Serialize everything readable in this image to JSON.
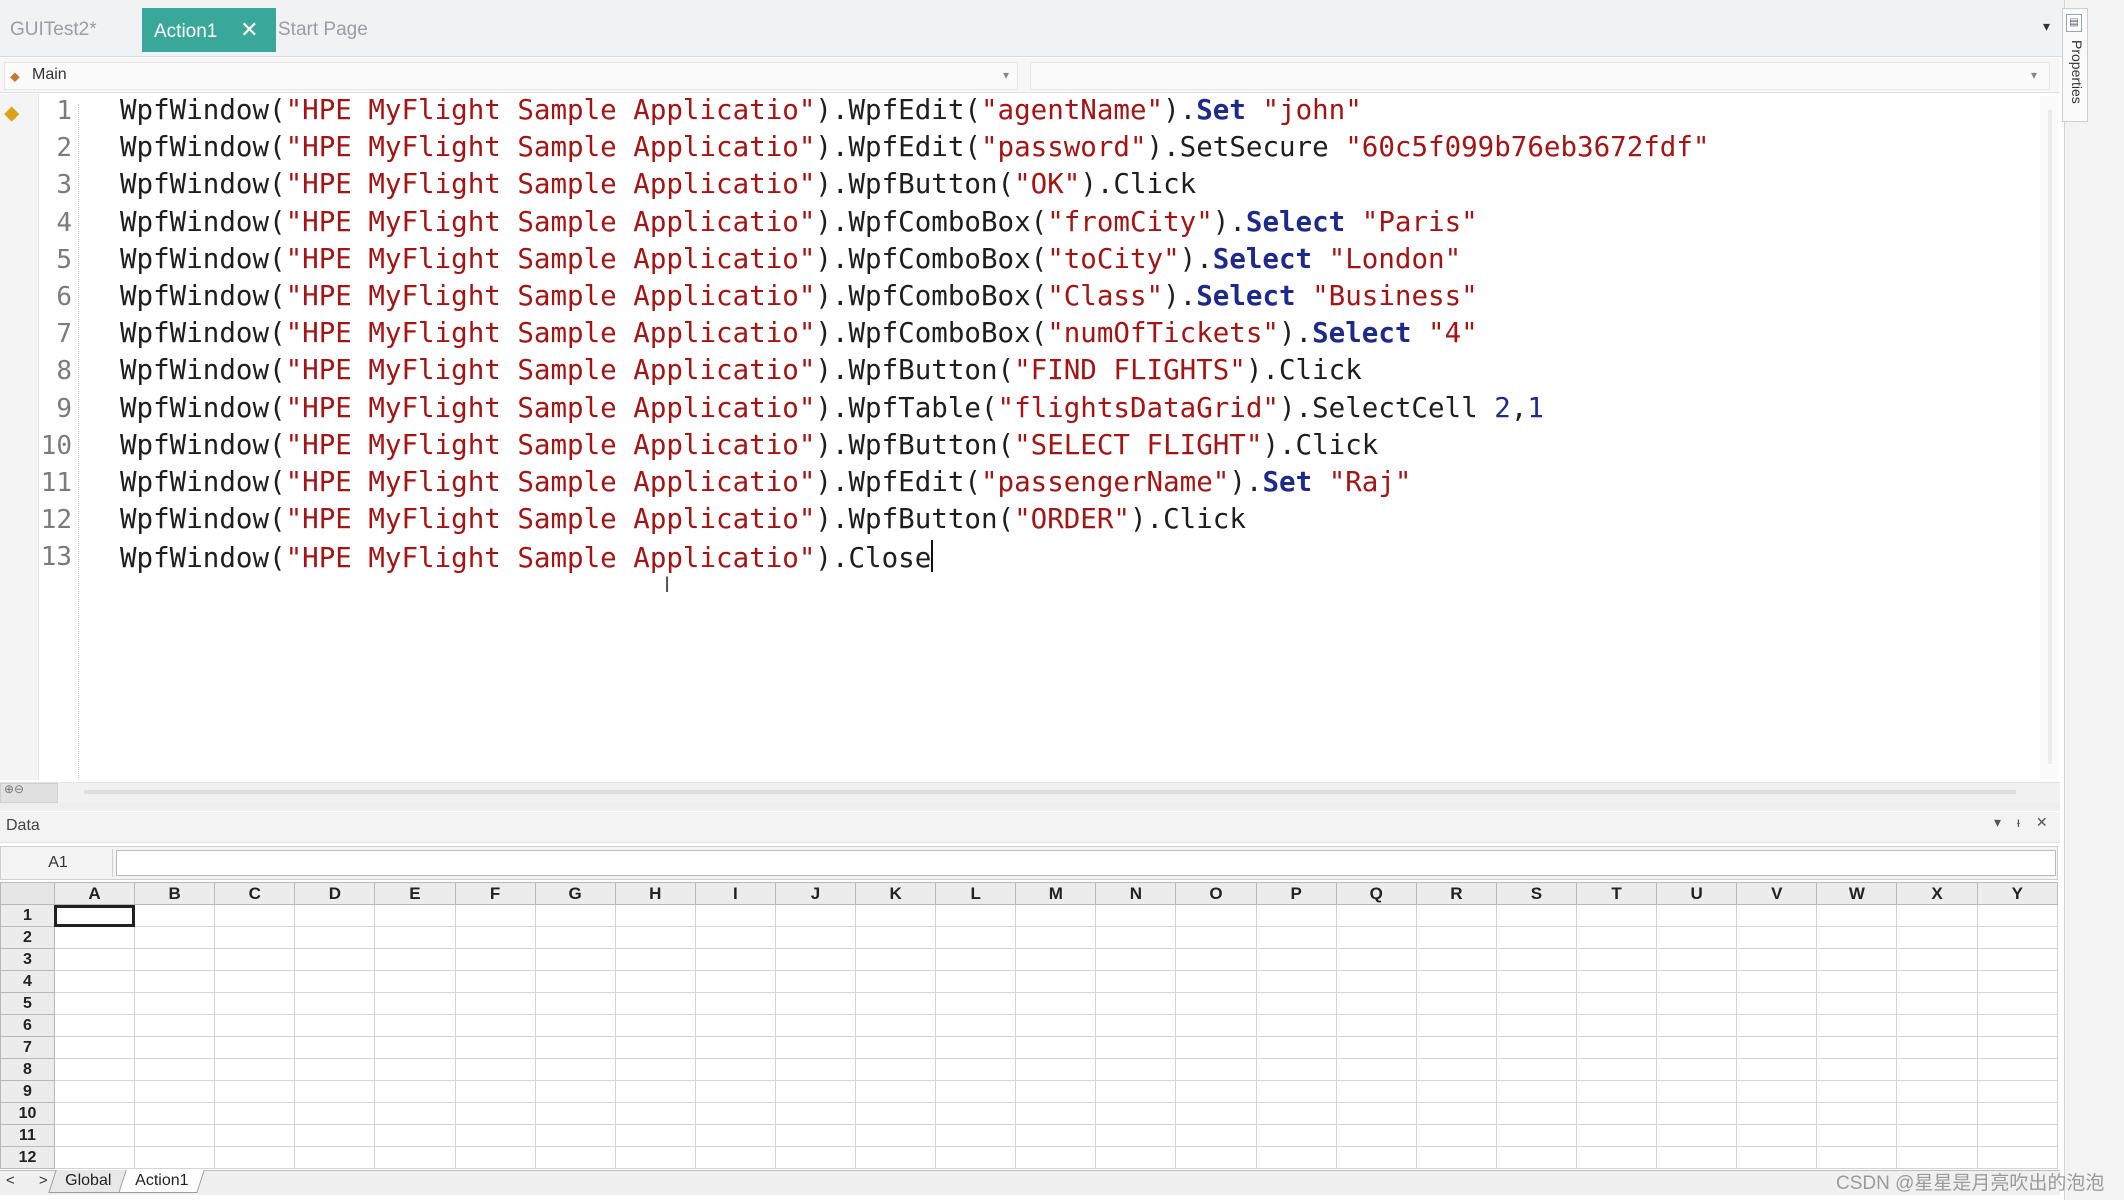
{
  "tabs": [
    {
      "label": "GUITest2*",
      "active": false
    },
    {
      "label": "Action1",
      "active": true
    },
    {
      "label": "Start Page",
      "active": false
    }
  ],
  "tab_close_glyph": "✕",
  "properties_panel": {
    "label": "Properties"
  },
  "nav": {
    "scope": "Main"
  },
  "editor": {
    "line_numbers": [
      "1",
      "2",
      "3",
      "4",
      "5",
      "6",
      "7",
      "8",
      "9",
      "10",
      "11",
      "12",
      "13"
    ],
    "lines": [
      [
        {
          "t": "WpfWindow(",
          "c": ""
        },
        {
          "t": "\"HPE MyFlight Sample Applicatio\"",
          "c": "str"
        },
        {
          "t": ").WpfEdit(",
          "c": ""
        },
        {
          "t": "\"agentName\"",
          "c": "str"
        },
        {
          "t": ").",
          "c": ""
        },
        {
          "t": "Set",
          "c": "kw"
        },
        {
          "t": " ",
          "c": ""
        },
        {
          "t": "\"john\"",
          "c": "str"
        }
      ],
      [
        {
          "t": "WpfWindow(",
          "c": ""
        },
        {
          "t": "\"HPE MyFlight Sample Applicatio\"",
          "c": "str"
        },
        {
          "t": ").WpfEdit(",
          "c": ""
        },
        {
          "t": "\"password\"",
          "c": "str"
        },
        {
          "t": ").SetSecure ",
          "c": ""
        },
        {
          "t": "\"60c5f099b76eb3672fdf\"",
          "c": "str"
        }
      ],
      [
        {
          "t": "WpfWindow(",
          "c": ""
        },
        {
          "t": "\"HPE MyFlight Sample Applicatio\"",
          "c": "str"
        },
        {
          "t": ").WpfButton(",
          "c": ""
        },
        {
          "t": "\"OK\"",
          "c": "str"
        },
        {
          "t": ").Click",
          "c": ""
        }
      ],
      [
        {
          "t": "WpfWindow(",
          "c": ""
        },
        {
          "t": "\"HPE MyFlight Sample Applicatio\"",
          "c": "str"
        },
        {
          "t": ").WpfComboBox(",
          "c": ""
        },
        {
          "t": "\"fromCity\"",
          "c": "str"
        },
        {
          "t": ").",
          "c": ""
        },
        {
          "t": "Select",
          "c": "kw"
        },
        {
          "t": " ",
          "c": ""
        },
        {
          "t": "\"Paris\"",
          "c": "str"
        }
      ],
      [
        {
          "t": "WpfWindow(",
          "c": ""
        },
        {
          "t": "\"HPE MyFlight Sample Applicatio\"",
          "c": "str"
        },
        {
          "t": ").WpfComboBox(",
          "c": ""
        },
        {
          "t": "\"toCity\"",
          "c": "str"
        },
        {
          "t": ").",
          "c": ""
        },
        {
          "t": "Select",
          "c": "kw"
        },
        {
          "t": " ",
          "c": ""
        },
        {
          "t": "\"London\"",
          "c": "str"
        }
      ],
      [
        {
          "t": "WpfWindow(",
          "c": ""
        },
        {
          "t": "\"HPE MyFlight Sample Applicatio\"",
          "c": "str"
        },
        {
          "t": ").WpfComboBox(",
          "c": ""
        },
        {
          "t": "\"Class\"",
          "c": "str"
        },
        {
          "t": ").",
          "c": ""
        },
        {
          "t": "Select",
          "c": "kw"
        },
        {
          "t": " ",
          "c": ""
        },
        {
          "t": "\"Business\"",
          "c": "str"
        }
      ],
      [
        {
          "t": "WpfWindow(",
          "c": ""
        },
        {
          "t": "\"HPE MyFlight Sample Applicatio\"",
          "c": "str"
        },
        {
          "t": ").WpfComboBox(",
          "c": ""
        },
        {
          "t": "\"numOfTickets\"",
          "c": "str"
        },
        {
          "t": ").",
          "c": ""
        },
        {
          "t": "Select",
          "c": "kw"
        },
        {
          "t": " ",
          "c": ""
        },
        {
          "t": "\"4\"",
          "c": "str"
        }
      ],
      [
        {
          "t": "WpfWindow(",
          "c": ""
        },
        {
          "t": "\"HPE MyFlight Sample Applicatio\"",
          "c": "str"
        },
        {
          "t": ").WpfButton(",
          "c": ""
        },
        {
          "t": "\"FIND FLIGHTS\"",
          "c": "str"
        },
        {
          "t": ").Click",
          "c": ""
        }
      ],
      [
        {
          "t": "WpfWindow(",
          "c": ""
        },
        {
          "t": "\"HPE MyFlight Sample Applicatio\"",
          "c": "str"
        },
        {
          "t": ").WpfTable(",
          "c": ""
        },
        {
          "t": "\"flightsDataGrid\"",
          "c": "str"
        },
        {
          "t": ").SelectCell ",
          "c": ""
        },
        {
          "t": "2",
          "c": "num"
        },
        {
          "t": ",",
          "c": ""
        },
        {
          "t": "1",
          "c": "num"
        }
      ],
      [
        {
          "t": "WpfWindow(",
          "c": ""
        },
        {
          "t": "\"HPE MyFlight Sample Applicatio\"",
          "c": "str"
        },
        {
          "t": ").WpfButton(",
          "c": ""
        },
        {
          "t": "\"SELECT FLIGHT\"",
          "c": "str"
        },
        {
          "t": ").Click",
          "c": ""
        }
      ],
      [
        {
          "t": "WpfWindow(",
          "c": ""
        },
        {
          "t": "\"HPE MyFlight Sample Applicatio\"",
          "c": "str"
        },
        {
          "t": ").WpfEdit(",
          "c": ""
        },
        {
          "t": "\"passengerName\"",
          "c": "str"
        },
        {
          "t": ").",
          "c": ""
        },
        {
          "t": "Set",
          "c": "kw"
        },
        {
          "t": " ",
          "c": ""
        },
        {
          "t": "\"Raj\"",
          "c": "str"
        }
      ],
      [
        {
          "t": "WpfWindow(",
          "c": ""
        },
        {
          "t": "\"HPE MyFlight Sample Applicatio\"",
          "c": "str"
        },
        {
          "t": ").WpfButton(",
          "c": ""
        },
        {
          "t": "\"ORDER\"",
          "c": "str"
        },
        {
          "t": ").Click",
          "c": ""
        }
      ],
      [
        {
          "t": "WpfWindow(",
          "c": ""
        },
        {
          "t": "\"HPE MyFlight Sample Applicatio\"",
          "c": "str"
        },
        {
          "t": ").Close",
          "c": ""
        }
      ]
    ],
    "caret_line": 13
  },
  "data_pane": {
    "title": "Data",
    "controls": "▾ ᵻ ✕",
    "cell_ref": "A1",
    "formula_value": "",
    "columns": [
      "A",
      "B",
      "C",
      "D",
      "E",
      "F",
      "G",
      "H",
      "I",
      "J",
      "K",
      "L",
      "M",
      "N",
      "O",
      "P",
      "Q",
      "R",
      "S",
      "T",
      "U",
      "V",
      "W",
      "X",
      "Y"
    ],
    "rows": [
      "1",
      "2",
      "3",
      "4",
      "5",
      "6",
      "7",
      "8",
      "9",
      "10",
      "11",
      "12"
    ],
    "selected_cell": "A1",
    "sheet_nav": "< >",
    "sheets": [
      {
        "label": "Global",
        "active": false
      },
      {
        "label": "Action1",
        "active": true
      }
    ]
  },
  "watermark": "CSDN @星星是月亮吹出的泡泡",
  "colors": {
    "active_tab": "#39a89a",
    "string": "#a31515",
    "keyword": "#1d2a8c"
  }
}
